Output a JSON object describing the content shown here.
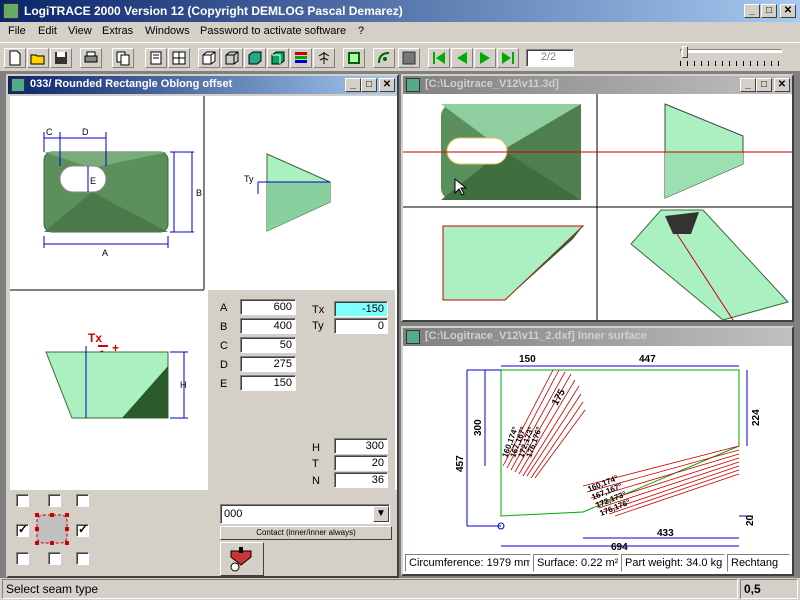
{
  "app": {
    "title": "LogiTRACE 2000  Version 12  (Copyright DEMLOG Pascal Demarez)"
  },
  "menu": [
    "File",
    "Edit",
    "View",
    "Extras",
    "Windows",
    "Password to activate software",
    "?"
  ],
  "toolbar": {
    "icons": [
      "new-file-icon",
      "open-folder-icon",
      "save-icon",
      "print-icon",
      "copy-icon",
      "page-view-icon",
      "grid-view-icon",
      "3d-box-outline-icon",
      "3d-box-green-icon",
      "3d-box-wire-icon",
      "color-bars-icon",
      "tree-icon",
      "frame-icon",
      "curve-icon",
      "gray-box-icon"
    ],
    "nav": [
      "first-page-icon",
      "previous-page-icon",
      "next-page-icon",
      "last-page-icon"
    ],
    "page_counter": "2/2"
  },
  "window1": {
    "title": "033/ Rounded Rectangle Oblong offset",
    "labels": {
      "A": "A",
      "B": "B",
      "C": "C",
      "D": "D",
      "E": "E",
      "Ty": "Ty",
      "H": "H",
      "Tx": "Tx",
      "minus": "-",
      "plus": "+"
    },
    "params": [
      {
        "name": "A",
        "value": "600"
      },
      {
        "name": "B",
        "value": "400"
      },
      {
        "name": "C",
        "value": "50"
      },
      {
        "name": "D",
        "value": "275"
      },
      {
        "name": "E",
        "value": "150"
      }
    ],
    "tx": {
      "label": "Tx",
      "value": "-150"
    },
    "ty": {
      "label": "Ty",
      "value": "0"
    },
    "h": {
      "label": "H",
      "value": "300"
    },
    "t": {
      "label": "T",
      "value": "20"
    },
    "n": {
      "label": "N",
      "value": "36"
    },
    "combo_value": "000",
    "contact_button": "Contact (inner/inner always)"
  },
  "window2": {
    "title": "[C:\\Logitrace_V12\\v11.3d]"
  },
  "window3": {
    "title": "[C:\\Logitrace_V12\\v11_2.dxf]  Inner surface",
    "dims": {
      "d150": "150",
      "d447": "447",
      "d300": "300",
      "d457": "457",
      "d224": "224",
      "d433": "433",
      "d694": "694",
      "d20": "20",
      "d175": "175"
    },
    "angles1": [
      "160,174°",
      "167,167°",
      "172,173°",
      "176,176°"
    ],
    "angles2": [
      "160,174°",
      "167,167°",
      "172,173°",
      "176,176°"
    ],
    "status": {
      "circumference": "Circumference: 1979 mm",
      "surface": "Surface: 0.22 m²",
      "weight": "Part weight: 34.0 kg",
      "shape": "Rechtang"
    }
  },
  "statusbar": {
    "message": "Select seam type",
    "value": "0,5"
  },
  "colors": {
    "title_active": "#0a246a",
    "face_green": "#5b8f5b",
    "face_light": "#aaf0c0",
    "dim_blue": "#0000cc",
    "seam_red": "#cc0000"
  }
}
